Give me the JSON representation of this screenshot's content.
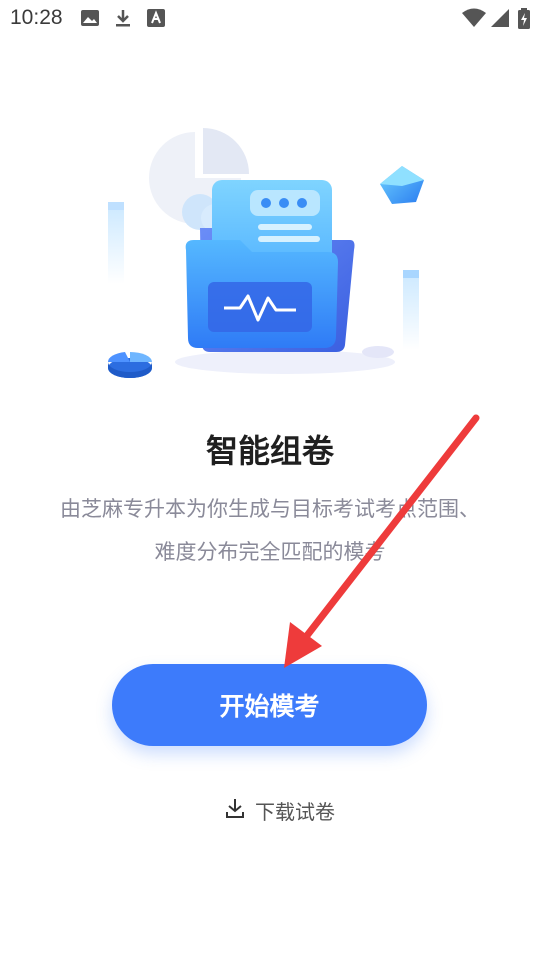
{
  "status_bar": {
    "time": "10:28",
    "icons": [
      "image-icon",
      "download-icon",
      "font-icon",
      "wifi-icon",
      "signal-icon",
      "battery-charging-icon"
    ]
  },
  "main": {
    "title": "智能组卷",
    "description_line1": "由芝麻专升本为你生成与目标考试考点范围、",
    "description_line2": "难度分布完全匹配的模考",
    "start_button_label": "开始模考",
    "download_label": "下载试卷"
  },
  "colors": {
    "accent": "#3d7bfb",
    "annotation_arrow": "#ee3b3b"
  }
}
